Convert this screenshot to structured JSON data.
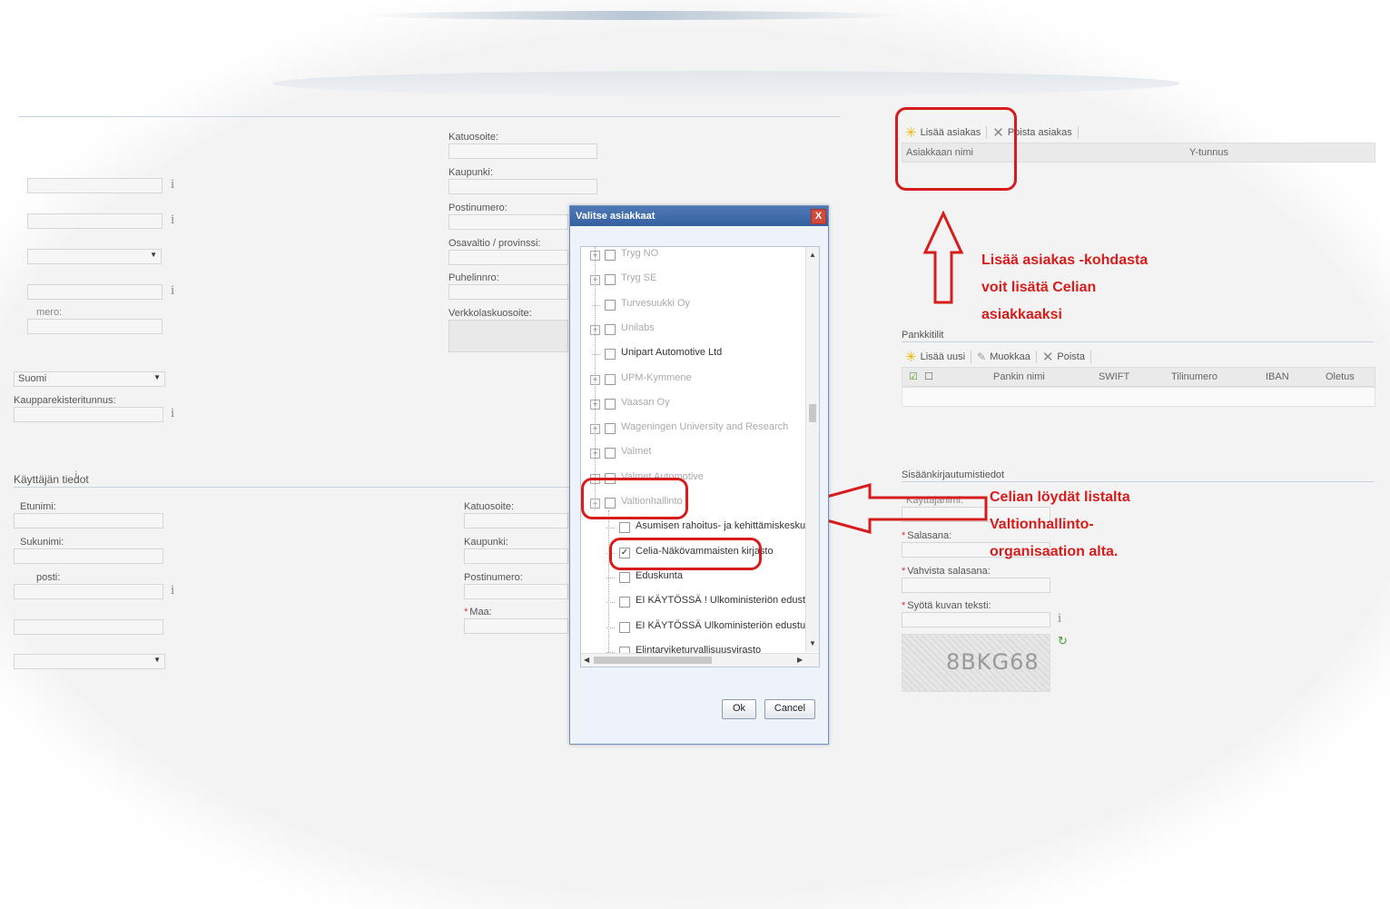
{
  "left_form": {
    "company_labels": [
      {
        "key": "city_label",
        "text": "Katuosoite:"
      },
      {
        "key": "kaupunki",
        "text": "Kaupunki:"
      },
      {
        "key": "postinumero",
        "text": "Postinumero:"
      },
      {
        "key": "osavaltio",
        "text": "Osavaltio / provinssi:"
      },
      {
        "key": "puhelin",
        "text": "Puhelinnro:"
      },
      {
        "key": "verkko",
        "text": "Verkkolaskuosoite:"
      }
    ],
    "partial_label_numero": "mero:",
    "country_value": "Suomi",
    "kaupparekisteri_label": "Kaupparekisteritunnus:",
    "user_section_title": "Käyttäjän tiedot",
    "user_labels": {
      "etunimi": "Etunimi:",
      "sukunimi": "Sukunimi:",
      "sahkoposti": "posti:"
    },
    "user_address_labels": {
      "katuosoite": "Katuosoite:",
      "kaupunki": "Kaupunki:",
      "postinumero": "Postinumero:",
      "maa": "Maa:"
    }
  },
  "clients_panel": {
    "add_client": "Lisää asiakas",
    "remove_client": "Poista asiakas",
    "col_name": "Asiakkaan nimi",
    "col_ytunnus": "Y-tunnus"
  },
  "banks_panel": {
    "title": "Pankkitilit",
    "add_new": "Lisää uusi",
    "edit": "Muokkaa",
    "delete": "Poista",
    "columns": [
      "Pankin nimi",
      "SWIFT",
      "Tilinumero",
      "IBAN",
      "Oletus"
    ]
  },
  "login_panel": {
    "title": "Sisäänkirjautumistiedot",
    "username_label": "Käyttäjänimi:",
    "password_label": "Salasana:",
    "confirm_label": "Vahvista salasana:",
    "captcha_label": "Syötä kuvan teksti:",
    "captcha_text": "8BKG68"
  },
  "dialog": {
    "title": "Valitse asiakkaat",
    "close": "X",
    "ok": "Ok",
    "cancel": "Cancel",
    "tree": [
      {
        "label": "Tryg NO",
        "dim": true,
        "expandable": true,
        "checked": false
      },
      {
        "label": "Tryg SE",
        "dim": true,
        "expandable": true,
        "checked": false
      },
      {
        "label": "Turvesuukki Oy",
        "dim": true,
        "expandable": false,
        "checked": false
      },
      {
        "label": "Unilabs",
        "dim": true,
        "expandable": true,
        "checked": false
      },
      {
        "label": "Unipart Automotive Ltd",
        "dim": false,
        "expandable": false,
        "checked": false
      },
      {
        "label": "UPM-Kymmene",
        "dim": true,
        "expandable": true,
        "checked": false
      },
      {
        "label": "Vaasan Oy",
        "dim": true,
        "expandable": true,
        "checked": false
      },
      {
        "label": "Wageningen University and Research",
        "dim": true,
        "expandable": true,
        "checked": false
      },
      {
        "label": "Valmet",
        "dim": true,
        "expandable": true,
        "checked": false
      },
      {
        "label": "Valmet Automotive",
        "dim": true,
        "expandable": true,
        "checked": false
      },
      {
        "label": "Valtionhallinto",
        "dim": true,
        "expandable": true,
        "checked": false,
        "expanded": true
      },
      {
        "label": "Asumisen rahoitus- ja kehittämiskeskus",
        "dim": false,
        "child": true,
        "checked": false
      },
      {
        "label": "Celia-Näkövammaisten kirjasto",
        "dim": false,
        "child": true,
        "checked": true
      },
      {
        "label": "Eduskunta",
        "dim": false,
        "child": true,
        "checked": false
      },
      {
        "label": "EI KÄYTÖSSÄ ! Ulkoministeriön edustusto, Islama",
        "dim": false,
        "child": true,
        "checked": false
      },
      {
        "label": "EI KÄYTÖSSÄ Ulkoministeriön edustusto, Sydney",
        "dim": false,
        "child": true,
        "checked": false
      },
      {
        "label": "Elintarviketurvallisuusvirasto",
        "dim": false,
        "child": true,
        "checked": false
      }
    ]
  },
  "annotations": {
    "add_client_note": [
      "Lisää asiakas -kohdasta",
      "voit lisätä Celian",
      "asiakkaaksi"
    ],
    "find_celia_note": [
      "Celian löydät listalta",
      "Valtionhallinto-",
      "organisaation alta."
    ],
    "color": "#d71c1c"
  }
}
